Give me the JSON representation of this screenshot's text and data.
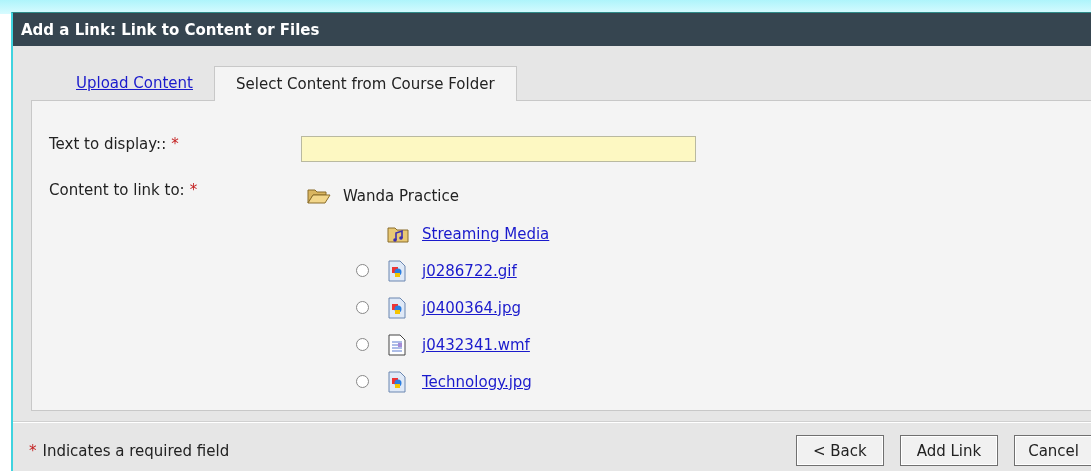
{
  "window": {
    "title": "Add a Link: Link to Content or Files"
  },
  "tabs": [
    {
      "label": "Upload Content",
      "selected": false
    },
    {
      "label": "Select Content from Course Folder",
      "selected": true
    }
  ],
  "form": {
    "text_to_display": {
      "label": "Text to display::",
      "required_mark": "*"
    },
    "content_to_link_to": {
      "label": "Content to link to:",
      "required_mark": "*"
    }
  },
  "tree": {
    "root": {
      "label": "Wanda Practice",
      "kind": "open-folder"
    },
    "children": [
      {
        "label": "Streaming Media",
        "kind": "media-folder"
      },
      {
        "label": "j0286722.gif",
        "kind": "image",
        "selected": false
      },
      {
        "label": "j0400364.jpg",
        "kind": "image",
        "selected": false
      },
      {
        "label": "j0432341.wmf",
        "kind": "document",
        "selected": false
      },
      {
        "label": "Technology.jpg",
        "kind": "image",
        "selected": false
      }
    ]
  },
  "footer": {
    "required_mark": "*",
    "note": "Indicates a required field"
  },
  "buttons": [
    "< Back",
    "Add Link",
    "Cancel"
  ]
}
